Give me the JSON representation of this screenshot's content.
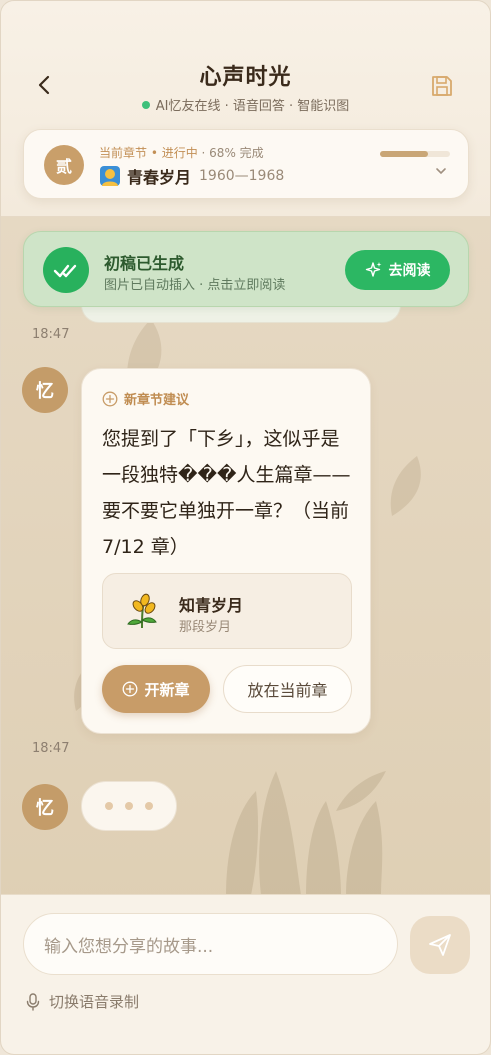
{
  "header": {
    "title": "心声时光",
    "status": "AI忆友在线 · 语音回答 · 智能识图",
    "status_color": "#3ec07a"
  },
  "chapter": {
    "badge": "贰",
    "meta": "当前章节 • 进行中",
    "progress_text": "· 68% 完成",
    "progress": 0.68,
    "name": "青春岁月",
    "years": "1960—1968",
    "icon": "sunrise-person-icon"
  },
  "notice": {
    "title": "初稿已生成",
    "subtitle": "图片已自动插入 · 点击立即阅读",
    "button": "去阅读",
    "accent": "#2cb763"
  },
  "messages": [
    {
      "time": "18:47",
      "avatar": "忆",
      "tag": "新章节建议",
      "text": "您提到了「下乡」，这似乎是一段独特���人生篇章——要不要它单独开一章？（当前 7/12 章）",
      "option_title": "知青岁月",
      "option_sub": "那段岁月",
      "option_icon": "wheat-icon",
      "primary_button": "开新章",
      "secondary_button": "放在当前章"
    },
    {
      "time": "18:47",
      "avatar": "忆",
      "typing": true
    }
  ],
  "footer": {
    "placeholder": "输入您想分享的故事...",
    "voice_toggle": "切换语音录制"
  },
  "colors": {
    "accent": "#c89c68",
    "background": "#e4d6bf"
  }
}
